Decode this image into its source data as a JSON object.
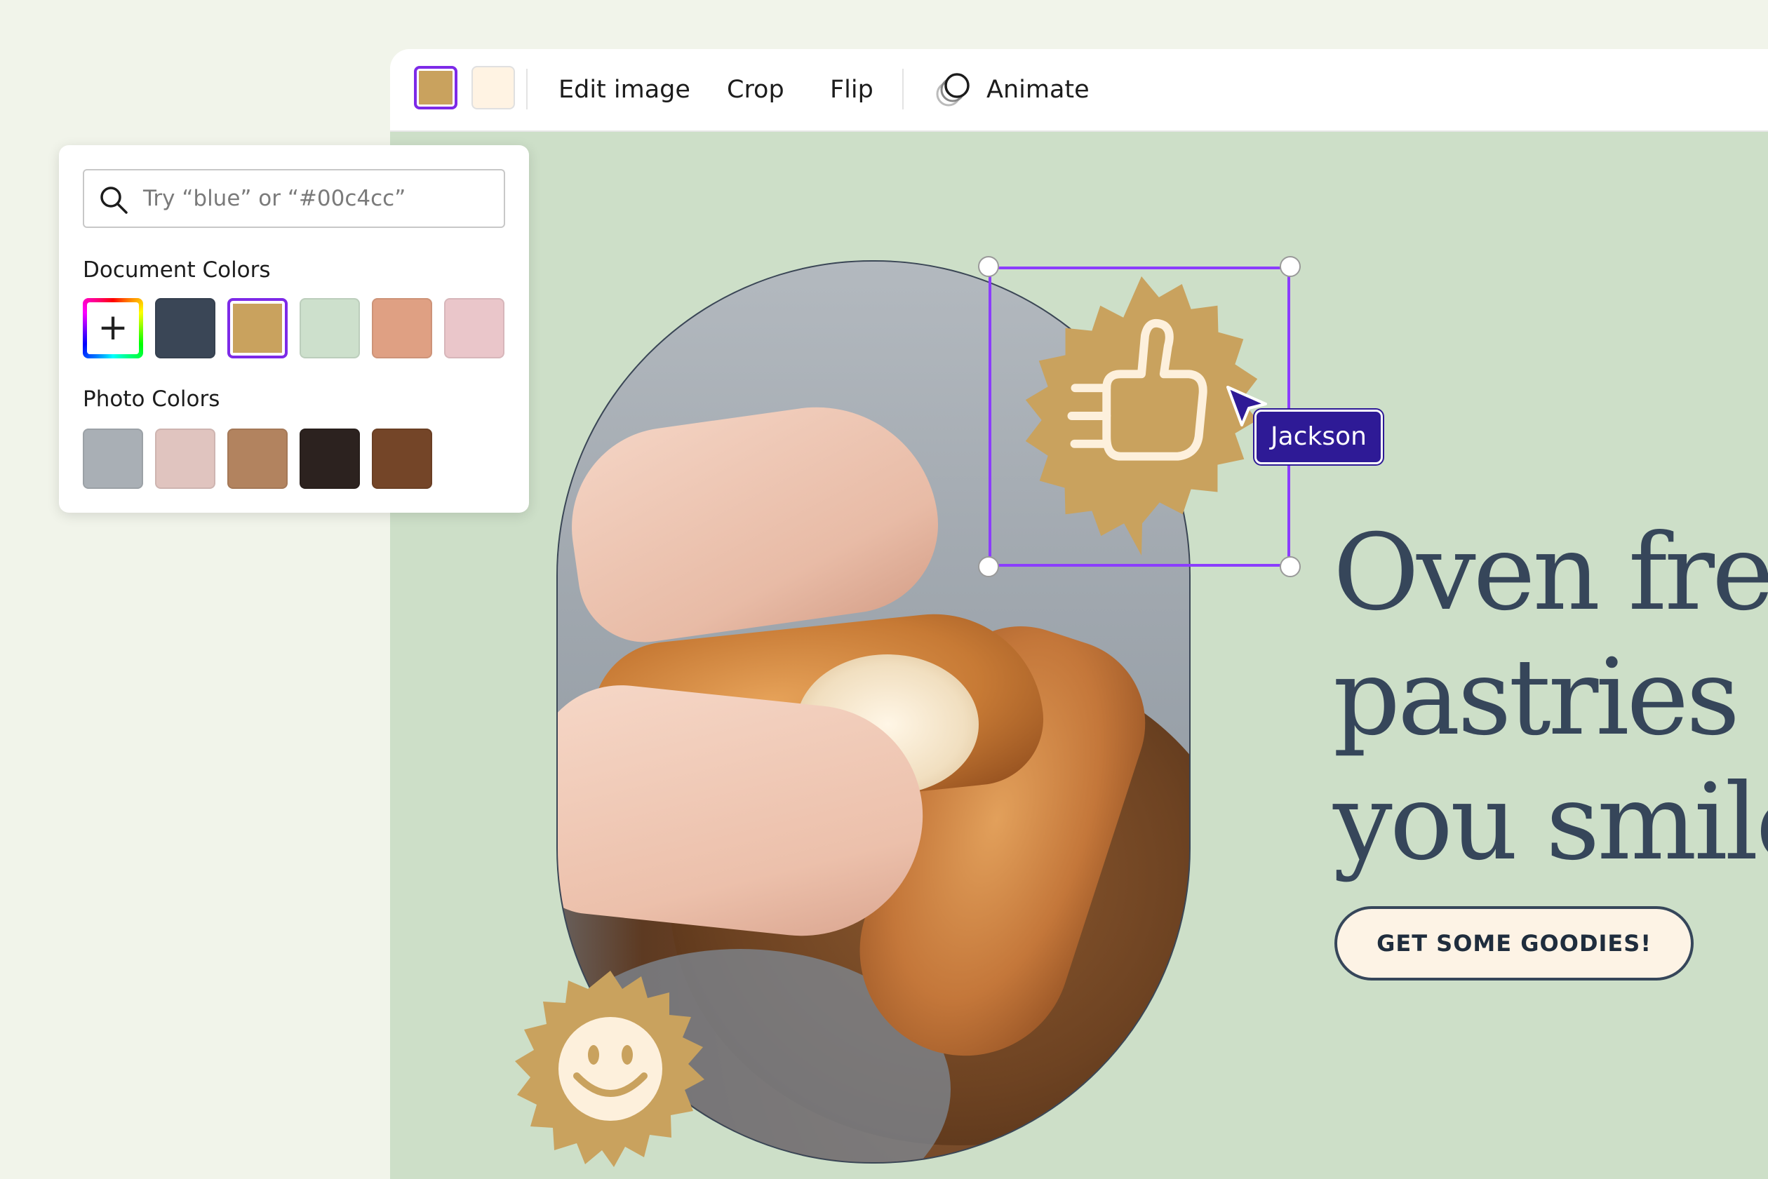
{
  "toolbar": {
    "current_color": "#c9a25e",
    "secondary_color": "#fff3e3",
    "edit_image": "Edit image",
    "crop": "Crop",
    "flip": "Flip",
    "animate": "Animate"
  },
  "color_panel": {
    "search_placeholder": "Try “blue” or “#00c4cc”",
    "document_colors_title": "Document Colors",
    "document_colors": [
      "#3a4656",
      "#c9a25e",
      "#cde0cc",
      "#dfa083",
      "#eac6ca"
    ],
    "photo_colors_title": "Photo Colors",
    "photo_colors": [
      "#a9afb5",
      "#e0c4bf",
      "#b2835f",
      "#2c221f",
      "#744528"
    ]
  },
  "canvas": {
    "background": "#cddfc8",
    "collaborator_name": "Jackson",
    "headline_lines": [
      "Oven fres",
      "pastries t",
      "you smile"
    ],
    "cta_label": "GET SOME GOODIES!"
  }
}
